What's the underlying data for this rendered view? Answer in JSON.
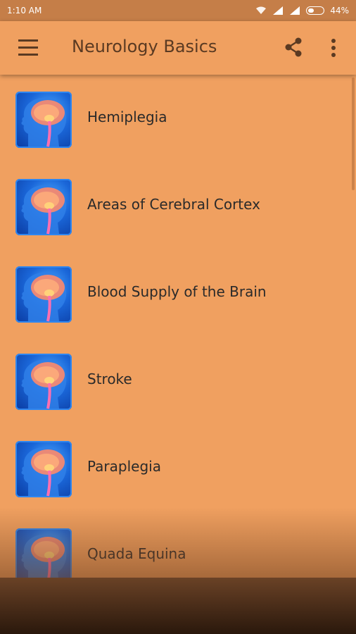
{
  "status_bar": {
    "time": "1:10 AM",
    "battery": "44%",
    "battery_level": 0.44
  },
  "app_bar": {
    "title": "Neurology Basics"
  },
  "list": {
    "items": [
      {
        "label": "Hemiplegia"
      },
      {
        "label": "Areas of Cerebral Cortex"
      },
      {
        "label": "Blood Supply of the Brain"
      },
      {
        "label": "Stroke"
      },
      {
        "label": "Paraplegia"
      },
      {
        "label": "Quada Equina"
      }
    ],
    "icon": "brain-head-icon"
  },
  "colors": {
    "background": "#f0a060",
    "status_bar": "#c57e48",
    "title_text": "#5a3a22"
  }
}
